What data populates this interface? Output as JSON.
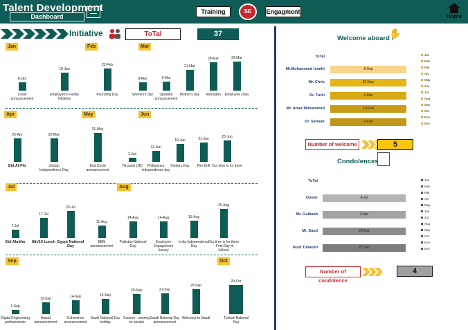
{
  "header": {
    "title": "Talent Development",
    "subtitle": "Dashboard",
    "nav": [
      {
        "label": "Training"
      },
      {
        "label": "Engagment"
      }
    ],
    "logo_text": "SE",
    "home_label": "Home"
  },
  "initiative": {
    "title": "Initiative",
    "total_label": "ToTal",
    "total_value": "37"
  },
  "chart_data": {
    "type": "bar",
    "ylabel": "",
    "xlabel": "",
    "rows": [
      {
        "months": [
          "Jan",
          "Feb",
          "Mar"
        ],
        "bars": [
          {
            "date": "8-Jan",
            "category": "Covid announcement",
            "value": 8
          },
          {
            "date": "18-Jan",
            "category": "Employee's Family Initiative",
            "value": 18
          },
          {
            "date": "22-Feb",
            "category": "Founding Day",
            "value": 22
          },
          {
            "date": "8-Mar",
            "category": "Women's day",
            "value": 8
          },
          {
            "date": "9-Mar",
            "category": "Updated announcement",
            "value": 9
          },
          {
            "date": "21-Mar",
            "category": "Mother's day",
            "value": 21
          },
          {
            "date": "28-Mar",
            "category": "Ramadan",
            "value": 28
          },
          {
            "date": "29-Mar",
            "category": "Employee Data",
            "value": 29
          }
        ]
      },
      {
        "months": [
          "Apr",
          "May",
          "Jun"
        ],
        "bars": [
          {
            "date": "25-Apr",
            "category": "Eid Al-Fitr",
            "value": 25
          },
          {
            "date": "25-May",
            "category": "Jordan Independence Day",
            "value": 25
          },
          {
            "date": "31-May",
            "category": "End Covid announcement",
            "value": 31
          },
          {
            "date": "1-Jun",
            "category": "TA posts (JB)",
            "value": 1
          },
          {
            "date": "12-Jun",
            "category": "Philippines independence day",
            "value": 12
          },
          {
            "date": "19-Jun",
            "category": "Fathers Day",
            "value": 19
          },
          {
            "date": "21-Jun",
            "category": "Fire Drill",
            "value": 21
          },
          {
            "date": "23-Jun",
            "category": "Our time is for them",
            "value": 23
          }
        ]
      },
      {
        "months": [
          "Jul",
          "Aug"
        ],
        "bars": [
          {
            "date": "7-Jul",
            "category": "Eid Aladha",
            "value": 7
          },
          {
            "date": "17-Jul",
            "category": "8th/10 Lunch",
            "value": 17
          },
          {
            "date": "23-Jul",
            "category": "Egypt National Day",
            "value": 23
          },
          {
            "date": "11-Aug",
            "category": "BBM announcement",
            "value": 11
          },
          {
            "date": "14-Aug",
            "category": "Pakistan National Day",
            "value": 14
          },
          {
            "date": "14-Aug",
            "category": "Employee Engagement Survey",
            "value": 14
          },
          {
            "date": "15-Aug",
            "category": "India Independence Day",
            "value": 15
          },
          {
            "date": "25-Aug",
            "category": "Our time is for them - First Day of School",
            "value": 25
          }
        ]
      },
      {
        "months": [
          "Sep",
          "Oct"
        ],
        "bars": [
          {
            "date": "1-Sep",
            "category": "Digital Engineering professionals",
            "value": 1
          },
          {
            "date": "12-Sep",
            "category": "Award announcement",
            "value": 12
          },
          {
            "date": "14-Sep",
            "category": "Coherence announcement",
            "value": 14
          },
          {
            "date": "15-Sep",
            "category": "Saudi National Day holiday",
            "value": 15
          },
          {
            "date": "20-Sep",
            "category": "Caution - sharing on socials",
            "value": 20
          },
          {
            "date": "21-Sep",
            "category": "Saudi National Day announcement",
            "value": 21
          },
          {
            "date": "25-Sep",
            "category": "Welcome to Saudi",
            "value": 25
          },
          {
            "date": "29-Oct",
            "category": "Turkish National Day",
            "value": 29
          }
        ]
      }
    ]
  },
  "welcome": {
    "title": "Welcome aboard !",
    "axis_total": "ToTal",
    "rows": [
      {
        "name": "Mr.Mohammed Ismith",
        "date": "8-Sep",
        "day": 8,
        "color": "#f8d48c"
      },
      {
        "name": "Mr. Chris",
        "date": "26-May",
        "day": 26,
        "color": "#e4b613"
      },
      {
        "name": "Dr. Turki",
        "date": "9-Mar",
        "day": 9,
        "color": "#d8ab16"
      },
      {
        "name": "Mr. Amer Mohammed",
        "date": "10-Feb",
        "day": 10,
        "color": "#c99c18"
      },
      {
        "name": "Dr. Sameer",
        "date": "3-Feb",
        "day": 3,
        "color": "#c29616"
      }
    ],
    "legend": [
      "Jan",
      "Feb",
      "Mar",
      "Apr",
      "May",
      "Jun",
      "Jul",
      "Aug",
      "Sep",
      "Oct",
      "Nov",
      "Dec"
    ],
    "count_label": "Number of welcome",
    "count_value": "5"
  },
  "condolences": {
    "title": "Condolences",
    "axis_total": "ToTal",
    "rows": [
      {
        "name": "Opiser",
        "date": "4-Jul",
        "day": 4,
        "color": "#b4b4b4"
      },
      {
        "name": "Mr. Gulbaab",
        "date": "3-Apr",
        "day": 3,
        "color": "#a4a4a4"
      },
      {
        "name": "Mr. Saud",
        "date": "28-Mar",
        "day": 28,
        "color": "#8c8c8c"
      },
      {
        "name": "Nouf Tubaishi",
        "date": "27-Jan",
        "day": 27,
        "color": "#7c7c7c"
      }
    ],
    "legend": [
      "Jan",
      "Feb",
      "Mar",
      "Apr",
      "May",
      "Jun",
      "Jul",
      "Aug",
      "Sep",
      "Oct",
      "Nov",
      "Dec"
    ],
    "count_label": "Number of condolence",
    "count_value": "4"
  }
}
